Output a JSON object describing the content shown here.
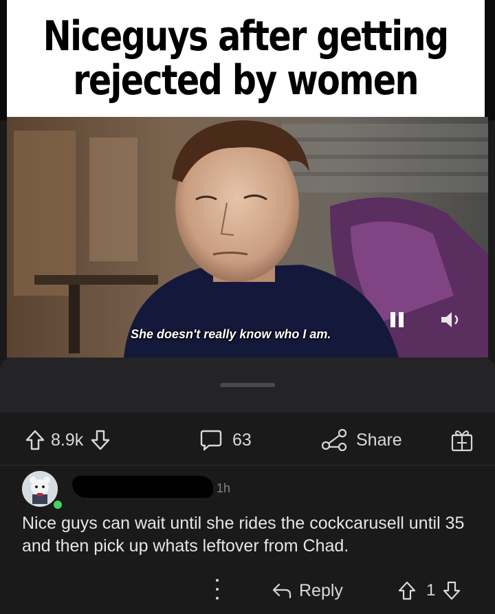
{
  "meme": {
    "caption_line1": "Niceguys after getting",
    "caption_line2": "rejected by women",
    "subtitle": "She doesn't really know who I am."
  },
  "post_actions": {
    "upvotes": "8.9k",
    "comments": "63",
    "share_label": "Share"
  },
  "comment": {
    "time": "1h",
    "body": "Nice guys can wait until she rides the cockcarusell until 35 and then pick up whats leftover from Chad.",
    "reply_label": "Reply",
    "votes": "1"
  },
  "colors": {
    "background": "#1a1a1b",
    "online": "#46d160",
    "text": "#d7dadc"
  }
}
